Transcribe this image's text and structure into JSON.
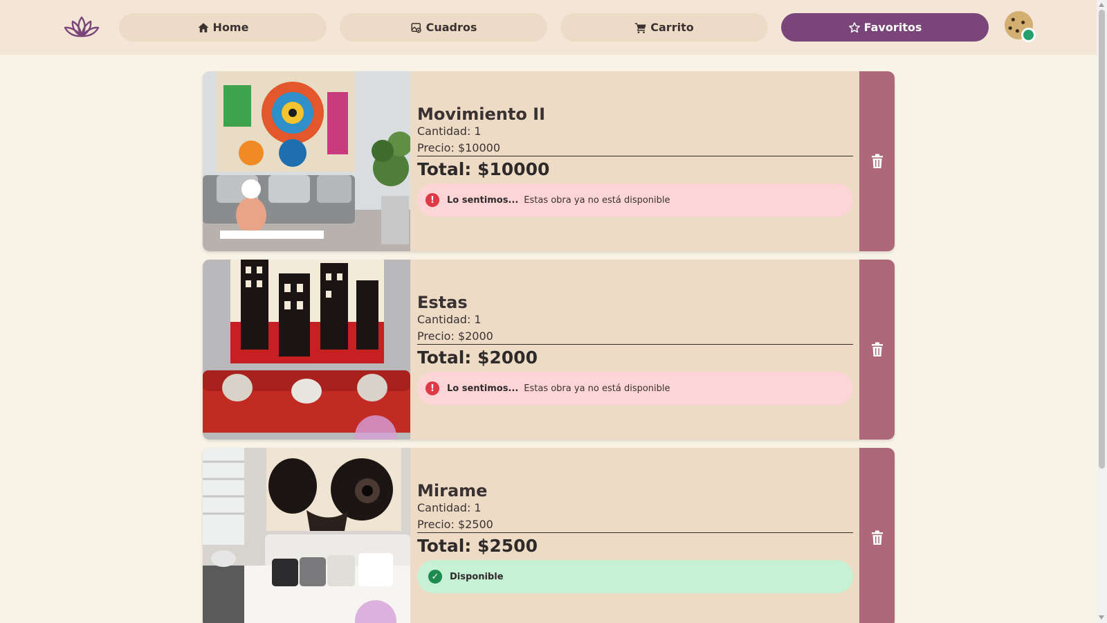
{
  "header": {
    "logo_icon": "lotus-icon",
    "nav": [
      {
        "label": "Home",
        "icon": "home-icon",
        "active": false
      },
      {
        "label": "Cuadros",
        "icon": "picture-icon",
        "active": false
      },
      {
        "label": "Carrito",
        "icon": "cart-icon",
        "active": false
      },
      {
        "label": "Favoritos",
        "icon": "star-icon",
        "active": true
      }
    ],
    "avatar_status": "online"
  },
  "colors": {
    "accent": "#7a4579",
    "delete": "#ae6879",
    "card": "#eddbc6",
    "background": "#f8f3e6",
    "error_bg": "#fdd5d7",
    "success_bg": "#c6f1d5"
  },
  "cart": {
    "items": [
      {
        "title": "Movimiento II",
        "quantity": "Cantidad: 1",
        "price": "Precio: $10000",
        "total": "Total: $10000",
        "status": {
          "type": "error",
          "icon": "!",
          "strong": "Lo sentimos...",
          "message": "Estas obra ya no está disponible"
        }
      },
      {
        "title": "Estas",
        "quantity": "Cantidad: 1",
        "price": "Precio: $2000",
        "total": "Total: $2000",
        "status": {
          "type": "error",
          "icon": "!",
          "strong": "Lo sentimos...",
          "message": "Estas obra ya no está disponible"
        }
      },
      {
        "title": "Mirame",
        "quantity": "Cantidad: 1",
        "price": "Precio: $2500",
        "total": "Total: $2500",
        "status": {
          "type": "ok",
          "icon": "✓",
          "strong": "Disponible",
          "message": ""
        }
      }
    ]
  }
}
